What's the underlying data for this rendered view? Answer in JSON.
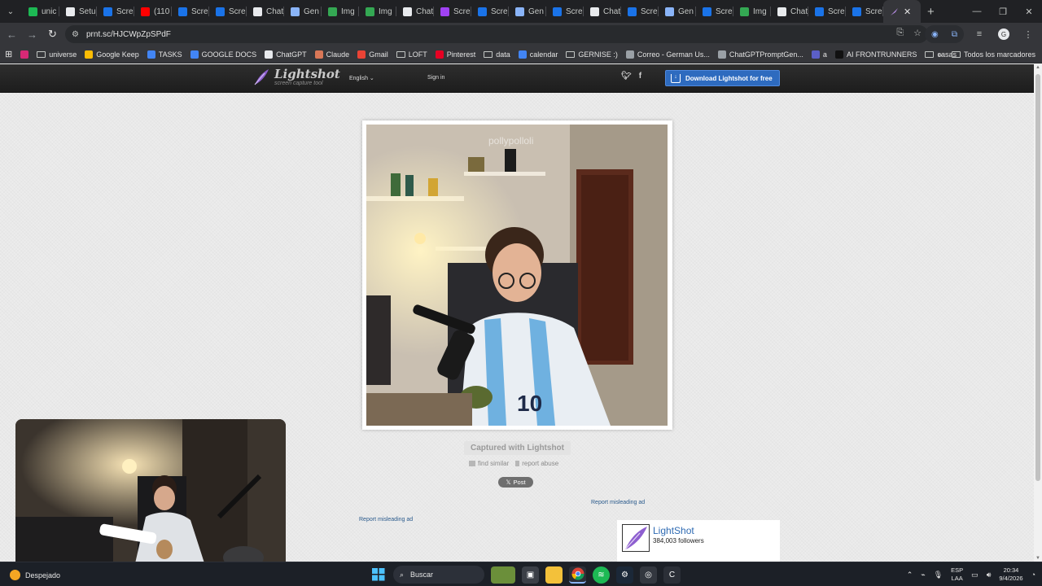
{
  "browser": {
    "tabs": [
      {
        "label": "unic",
        "color": "#1db954"
      },
      {
        "label": "Setu",
        "color": "#e8eaed"
      },
      {
        "label": "Scre",
        "color": "#1a73e8"
      },
      {
        "label": "(110",
        "color": "#ff0000"
      },
      {
        "label": "Scre",
        "color": "#1a73e8"
      },
      {
        "label": "Scre",
        "color": "#1a73e8"
      },
      {
        "label": "Chat",
        "color": "#e8eaed"
      },
      {
        "label": "Gen",
        "color": "#8ab4f8"
      },
      {
        "label": "Img",
        "color": "#34a853"
      },
      {
        "label": "Img",
        "color": "#34a853"
      },
      {
        "label": "Chat",
        "color": "#e8eaed"
      },
      {
        "label": "Scre",
        "color": "#a142f4"
      },
      {
        "label": "Scre",
        "color": "#1a73e8"
      },
      {
        "label": "Gen",
        "color": "#8ab4f8"
      },
      {
        "label": "Scre",
        "color": "#1a73e8"
      },
      {
        "label": "Chat",
        "color": "#e8eaed"
      },
      {
        "label": "Scre",
        "color": "#1a73e8"
      },
      {
        "label": "Gen",
        "color": "#8ab4f8"
      },
      {
        "label": "Scre",
        "color": "#1a73e8"
      },
      {
        "label": "Img",
        "color": "#34a853"
      },
      {
        "label": "Chat",
        "color": "#e8eaed"
      },
      {
        "label": "Scre",
        "color": "#1a73e8"
      },
      {
        "label": "Scre",
        "color": "#1a73e8"
      }
    ],
    "active_tab_close": "✕",
    "new_tab": "+",
    "url": "prnt.sc/HJCWpZpSPdF"
  },
  "bookmarks": [
    {
      "label": "universe",
      "kind": "folder"
    },
    {
      "label": "Google Keep",
      "kind": "site",
      "color": "#fbbc04"
    },
    {
      "label": "TASKS",
      "kind": "site",
      "color": "#4285f4"
    },
    {
      "label": "GOOGLE DOCS",
      "kind": "site",
      "color": "#4285f4"
    },
    {
      "label": "ChatGPT",
      "kind": "site",
      "color": "#e8eaed"
    },
    {
      "label": "Claude",
      "kind": "site",
      "color": "#d97757"
    },
    {
      "label": "Gmail",
      "kind": "site",
      "color": "#ea4335"
    },
    {
      "label": "LOFT",
      "kind": "folder"
    },
    {
      "label": "Pinterest",
      "kind": "site",
      "color": "#e60023"
    },
    {
      "label": "data",
      "kind": "folder"
    },
    {
      "label": "calendar",
      "kind": "site",
      "color": "#4285f4"
    },
    {
      "label": "GERNISE :)",
      "kind": "folder"
    },
    {
      "label": "Correo - German Us...",
      "kind": "site",
      "color": "#9aa0a6"
    },
    {
      "label": "ChatGPTPromptGen...",
      "kind": "site",
      "color": "#9aa0a6"
    },
    {
      "label": "a",
      "kind": "site",
      "color": "#5b5fc7"
    },
    {
      "label": "AI FRONTRUNNERS",
      "kind": "site",
      "color": "#111111"
    },
    {
      "label": "casas",
      "kind": "folder"
    }
  ],
  "bookmarks_all": "Todos los marcadores",
  "lightshot": {
    "brand": "Lightshot",
    "tagline": "screen capture tool",
    "language": "English",
    "signin": "Sign in",
    "download": "Download Lightshot for free",
    "watermark": "pollypolloli",
    "captured": "Captured with Lightshot",
    "find_similar": "find similar",
    "report_abuse": "report abuse",
    "post": "Post",
    "report_ad": "Report misleading ad",
    "widget_name": "LightShot",
    "widget_followers": "384,003 followers"
  },
  "taskbar": {
    "weather": "Despejado",
    "search": "Buscar",
    "lang_top": "ESP",
    "lang_bottom": "LAA",
    "time": "20:34",
    "date": "9/4/2026"
  }
}
